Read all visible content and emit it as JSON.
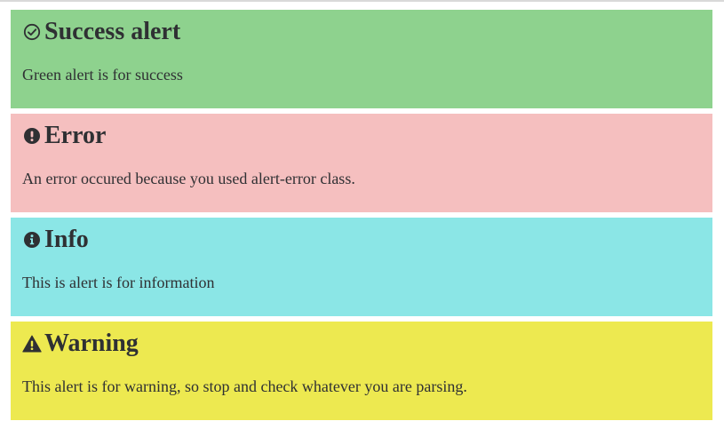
{
  "alerts": [
    {
      "variant": "success",
      "icon": "check-circle-icon",
      "title": "Success alert",
      "message": "Green alert is for success",
      "background": "#8ed28e"
    },
    {
      "variant": "error",
      "icon": "exclamation-circle-icon",
      "title": "Error",
      "message": "An error occured because you used alert-error class.",
      "background": "#f5bfbf"
    },
    {
      "variant": "info",
      "icon": "info-circle-icon",
      "title": "Info",
      "message": "This is alert is for information",
      "background": "#8be6e6"
    },
    {
      "variant": "warning",
      "icon": "warning-triangle-icon",
      "title": "Warning",
      "message": "This alert is for warning, so stop and check whatever you are parsing.",
      "background": "#ede950"
    }
  ],
  "colors": {
    "text": "#2f3033",
    "page_background": "#ffffff"
  }
}
